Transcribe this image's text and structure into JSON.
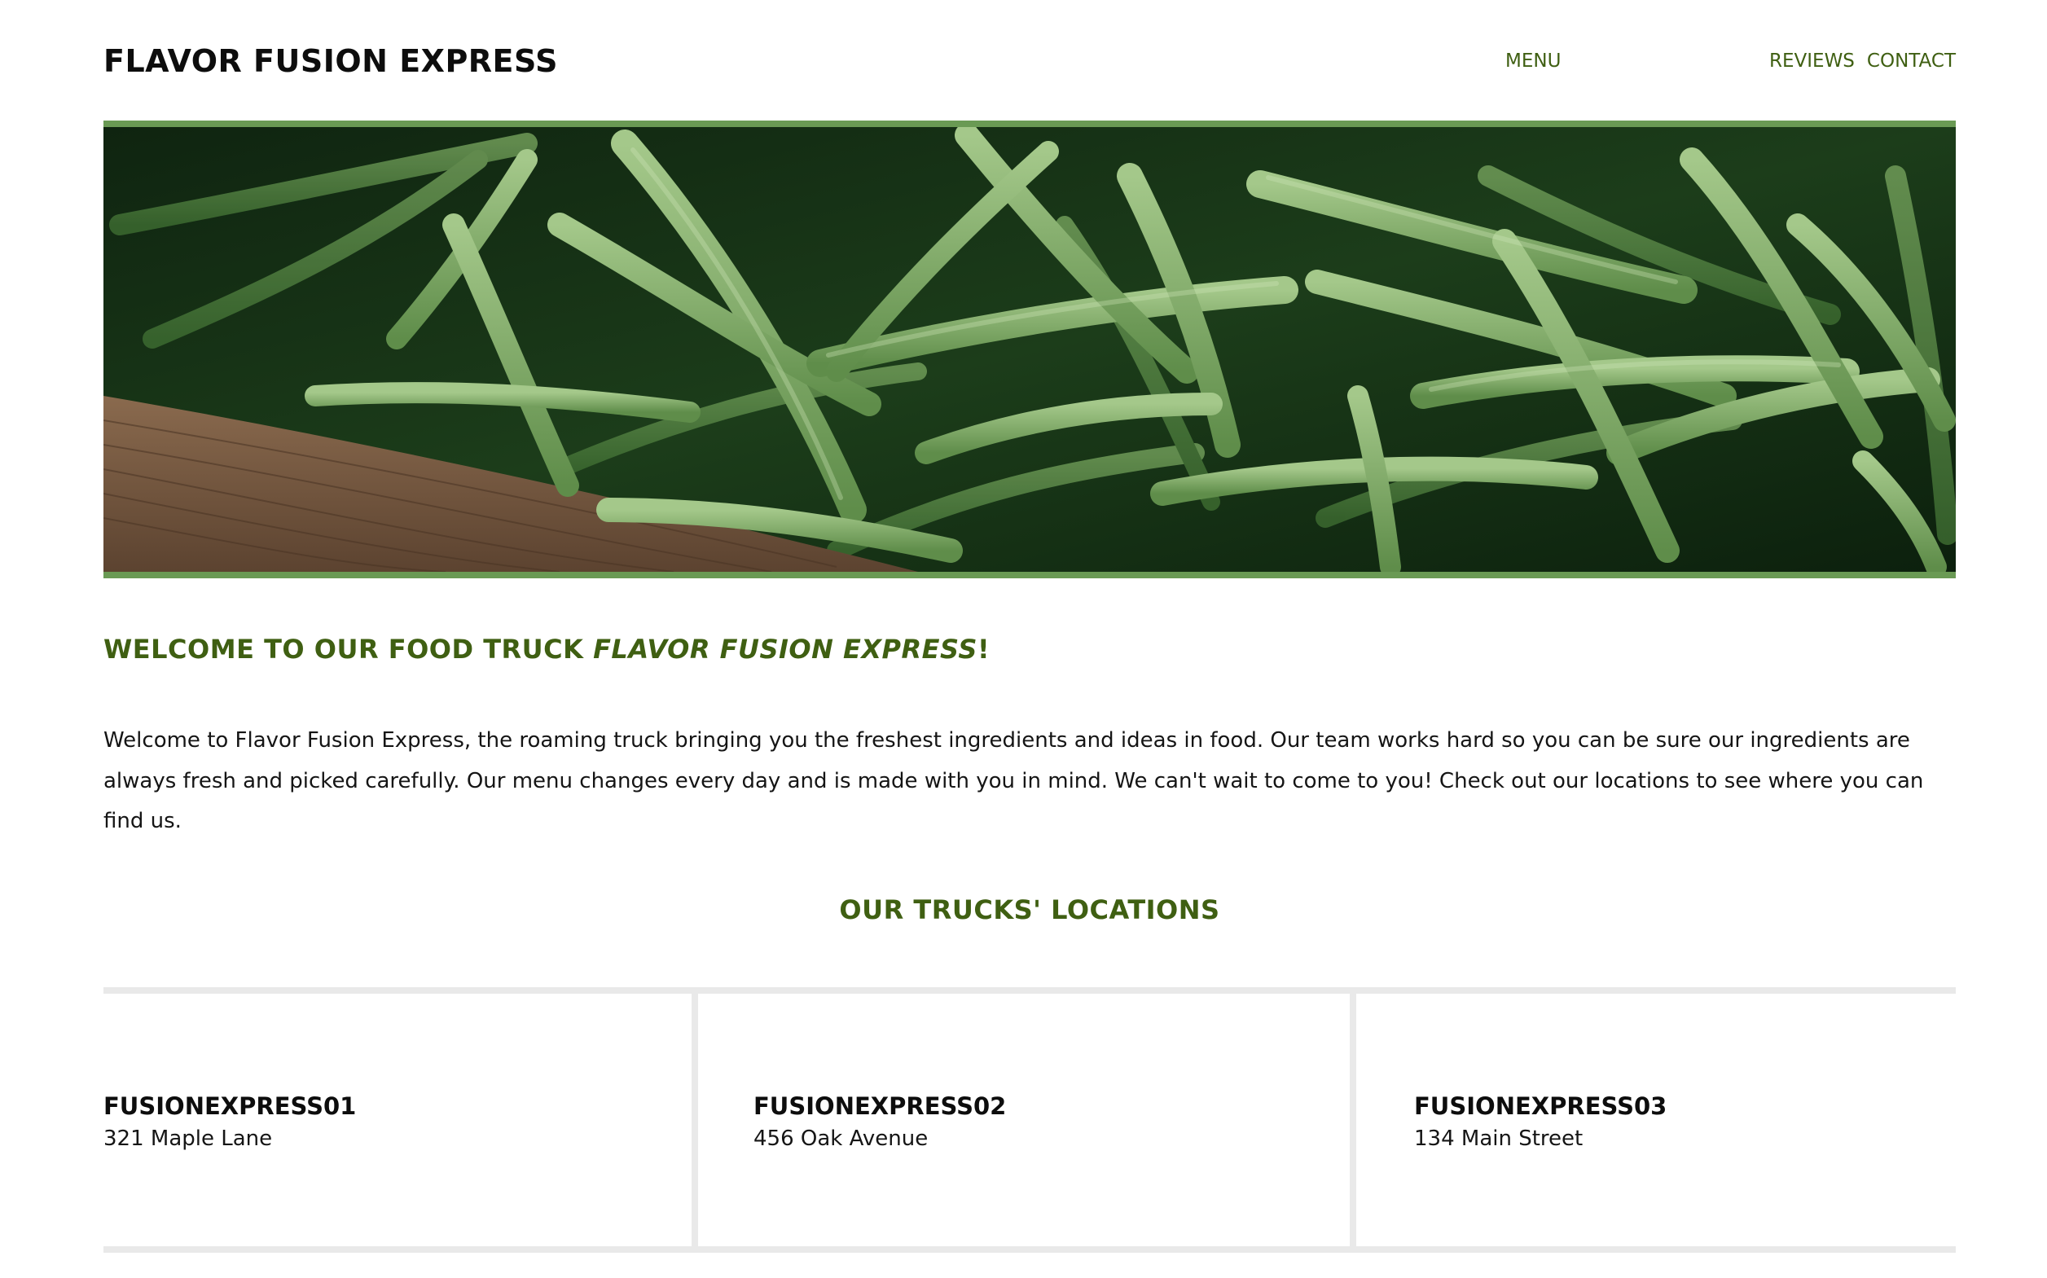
{
  "header": {
    "brand": "FLAVOR FUSION EXPRESS",
    "nav": [
      "MENU",
      "REVIEWS",
      "CONTACT"
    ]
  },
  "hero": {
    "image": "green-beans-photo",
    "frame_color": "#6a9a54"
  },
  "welcome": {
    "title_prefix": "WELCOME TO OUR FOOD TRUCK ",
    "title_name": "FLAVOR FUSION EXPRESS",
    "title_suffix": "!",
    "text": "Welcome to Flavor Fusion Express, the roaming truck bringing you the freshest ingredients and ideas in food. Our team works hard so you can be sure our ingredients are always fresh and picked carefully. Our menu changes every day and is made with you in mind. We can't wait to come to you! Check out our locations to see where you can find us."
  },
  "locations": {
    "title": "OUR TRUCKS' LOCATIONS",
    "items": [
      {
        "name": "FUSIONEXPRESS01",
        "address": "321 Maple Lane"
      },
      {
        "name": "FUSIONEXPRESS02",
        "address": "456 Oak Avenue"
      },
      {
        "name": "FUSIONEXPRESS03",
        "address": "134 Main Street"
      }
    ]
  },
  "colors": {
    "accent": "#3f5f12",
    "hero_frame": "#6a9a54",
    "divider": "#e9e9e9",
    "text": "#151515"
  }
}
